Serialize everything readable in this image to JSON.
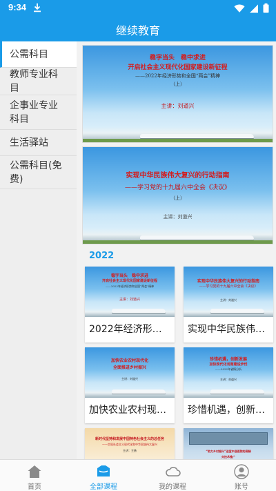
{
  "status_bar": {
    "time": "9:34"
  },
  "app": {
    "title": "继续教育"
  },
  "sidebar": {
    "items": [
      {
        "label": "公需科目",
        "active": true
      },
      {
        "label": "教师专业科目",
        "active": false
      },
      {
        "label": "企事业专业科目",
        "active": false
      },
      {
        "label": "生活驿站",
        "active": false
      },
      {
        "label": "公需科目(免费)",
        "active": false
      }
    ]
  },
  "banners": [
    {
      "line1": "稳字当头　稳中求进",
      "line2": "开启社会主义现代化国家建设新征程",
      "line3": "——2022年经济形势和全国“两会”精神",
      "line4": "（上）",
      "lecturer": "主讲：刘道兴"
    },
    {
      "line1": "实现中华民族伟大复兴的行动指南",
      "line2": "——学习党的十九届六中全会《决议》",
      "line3": "（上）",
      "lecturer": "主讲：刘道兴"
    }
  ],
  "section": {
    "year": "2022"
  },
  "courses": [
    {
      "title": "2022年经济形势…",
      "thumb_lines": [
        "稳字当头　稳中求进",
        "开启社会主义现代化国家建设新征程",
        "——2022年经济形势和全国“两会”精神",
        "主讲：刘道兴"
      ]
    },
    {
      "title": "实现中华民族伟…",
      "thumb_lines": [
        "实现中华民族伟大复兴的行动指南",
        "——学习党的十九届六中全会《决议》",
        "主讲：刘道兴"
      ]
    },
    {
      "title": "加快农业农村现…",
      "thumb_lines": [
        "加快农业农村现代化",
        "全面推进乡村振兴",
        "主讲：刘道兴"
      ]
    },
    {
      "title": "珍惜机遇，创新…",
      "thumb_lines": [
        "珍惜机遇，创新发展",
        "加快现代化河南建设步伐",
        "——2022年省情分析",
        "主讲：刘道兴"
      ]
    },
    {
      "title": "",
      "thumb_lines": [
        "新时代坚持和发展中国特色社会主义的总任务",
        "——实现社会主义现代化和中华民族伟大复兴",
        "主讲：王勇"
      ]
    },
    {
      "title": "",
      "thumb_lines": [
        "“助力乡村振兴”送宣中县医院的高精",
        "灾技术推广"
      ]
    }
  ],
  "tabs": [
    {
      "label": "首页",
      "icon": "home-icon",
      "active": false
    },
    {
      "label": "全部课程",
      "icon": "courses-icon",
      "active": true
    },
    {
      "label": "我的课程",
      "icon": "cloud-icon",
      "active": false
    },
    {
      "label": "账号",
      "icon": "account-icon",
      "active": false
    }
  ],
  "colors": {
    "primary": "#1a9be8",
    "title_red": "#c4161c"
  }
}
